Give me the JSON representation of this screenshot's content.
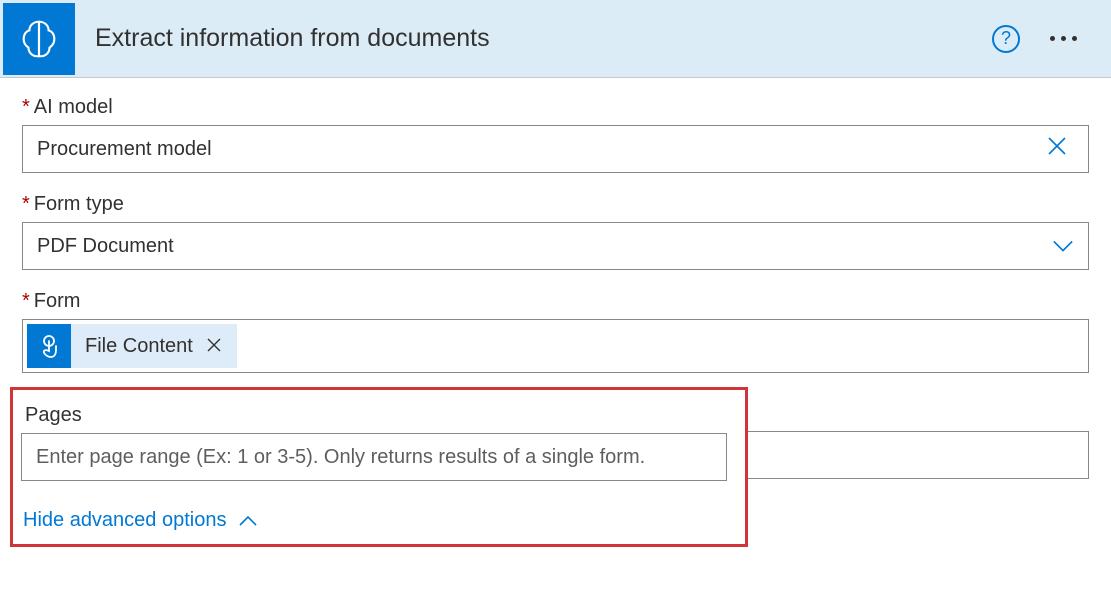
{
  "header": {
    "title": "Extract information from documents"
  },
  "fields": {
    "ai_model": {
      "label": "AI model",
      "value": "Procurement model"
    },
    "form_type": {
      "label": "Form type",
      "value": "PDF Document"
    },
    "form": {
      "label": "Form",
      "token_label": "File Content"
    },
    "pages": {
      "label": "Pages",
      "placeholder": "Enter page range (Ex: 1 or 3-5). Only returns results of a single form."
    }
  },
  "advanced": {
    "hide_label": "Hide advanced options"
  }
}
